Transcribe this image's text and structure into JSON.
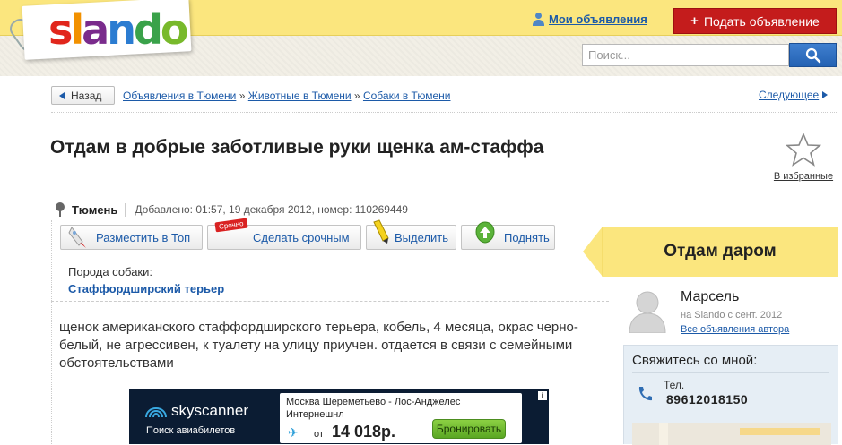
{
  "header": {
    "logo": {
      "letters": [
        "s",
        "l",
        "a",
        "n",
        "d",
        "o"
      ],
      "alt": "slando"
    },
    "my_ads_label": "Мои объявления",
    "post_ad_label": "Подать объявление",
    "post_ad_plus": "+",
    "search_placeholder": "Поиск..."
  },
  "breadcrumb": {
    "back_label": "Назад",
    "items": [
      "Объявления в Тюмени",
      "Животные в Тюмени",
      "Собаки в Тюмени"
    ],
    "separator": "»",
    "next_label": "Следующее"
  },
  "listing": {
    "title": "Отдам в добрые заботливые руки щенка ам-стаффа",
    "favorite_label": "В избранные",
    "city": "Тюмень",
    "added": "Добавлено: 01:57, 19 декабря 2012, номер: 110269449",
    "actions": [
      {
        "label": "Разместить в Топ",
        "icon": "rocket-icon"
      },
      {
        "label": "Сделать срочным",
        "icon": "urgent-tag-icon",
        "tag": "Срочно"
      },
      {
        "label": "Выделить",
        "icon": "highlighter-icon"
      },
      {
        "label": "Поднять",
        "icon": "up-arrow-icon"
      }
    ],
    "breed_label": "Порода собаки:",
    "breed_value": "Стаффордширский терьер",
    "description": "щенок американского стаффордширского терьера, кобель, 4 месяца, окрас черно-белый, не агрессивен, к туалету на улицу приучен. отдается в связи с семейными обстоятельствами"
  },
  "ad": {
    "brand": "skyscanner",
    "tagline": "Поиск авиабилетов",
    "route": "Москва Шереметьево - Лос-Анджелес",
    "airline": "Интернешнл",
    "from_label": "от",
    "price": "14 018р.",
    "book_label": "Бронировать",
    "info": "i"
  },
  "sidebar": {
    "price_banner": "Отдам даром",
    "seller_name": "Марсель",
    "seller_since": "на Slando с сент. 2012",
    "seller_all_ads": "Все объявления автора",
    "contact_title": "Свяжитесь со мной:",
    "tel_label": "Тел.",
    "tel_number": "89612018150"
  },
  "colors": {
    "topbar": "#fbe67e",
    "post_button": "#c41c1c",
    "link": "#1c5aa8",
    "search_button": "#2462b3",
    "price_banner": "#fbe67e",
    "contact_bg": "#e6eef5"
  }
}
